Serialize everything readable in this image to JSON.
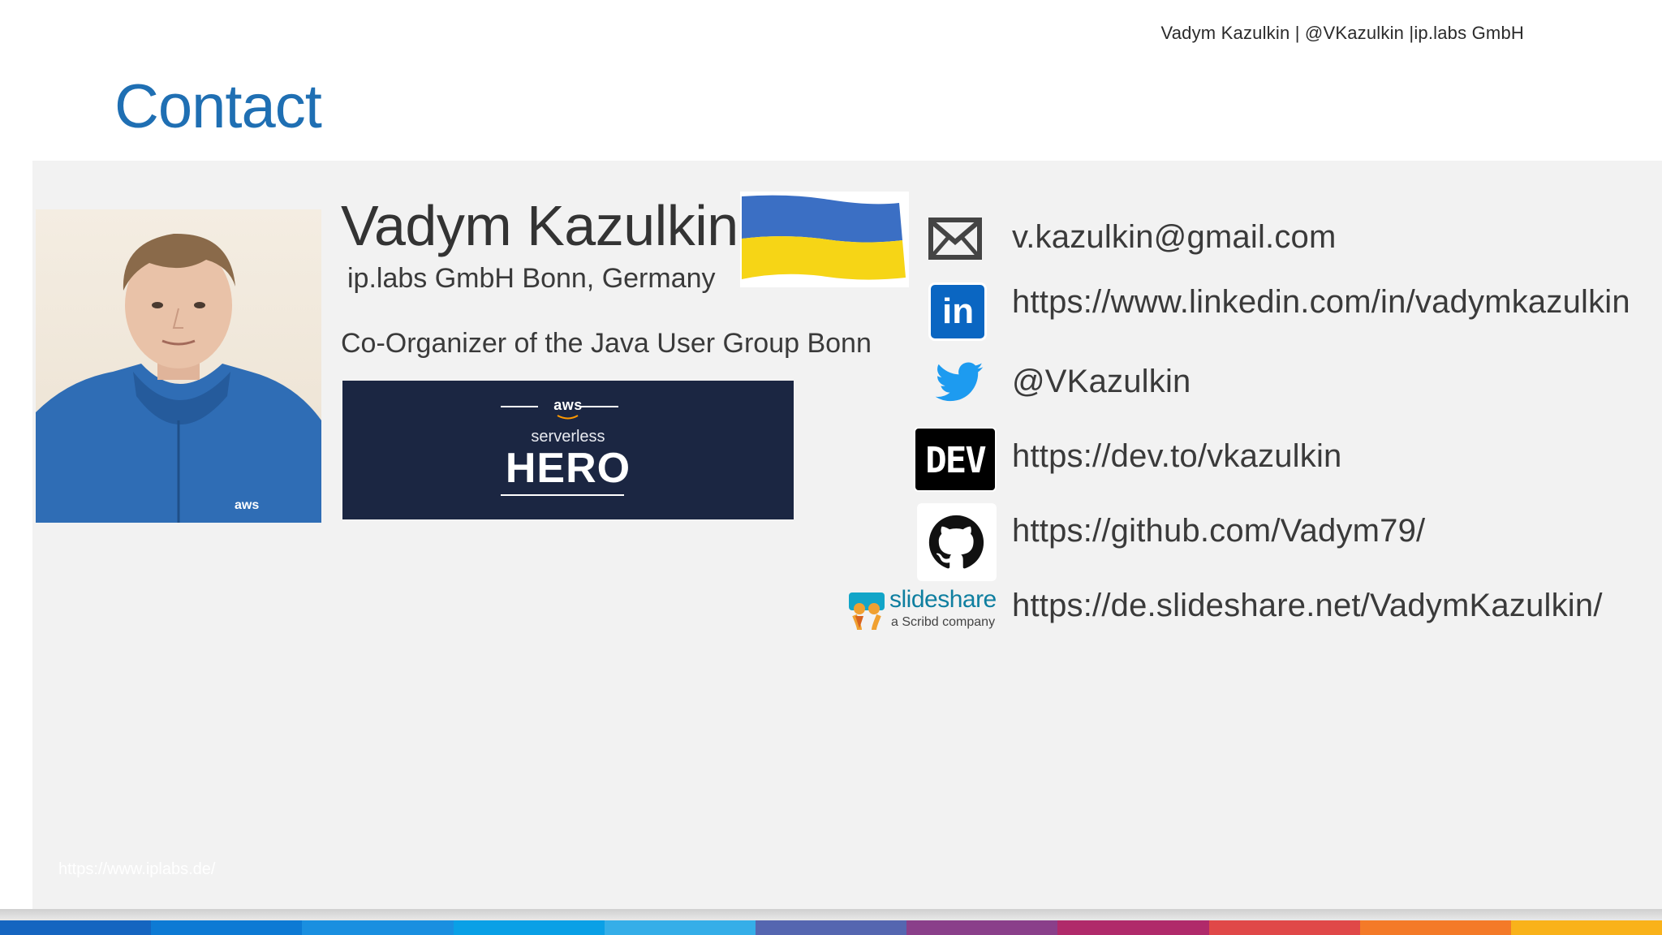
{
  "header": {
    "meta": "Vadym Kazulkin | @VKazulkin |ip.labs GmbH"
  },
  "slide": {
    "title": "Contact"
  },
  "profile": {
    "name": "Vadym Kazulkin",
    "company": "ip.labs GmbH Bonn, Germany",
    "role": "Co-Organizer of the Java User Group Bonn",
    "photo_badge": "aws"
  },
  "hero_badge": {
    "aws": "aws",
    "serverless": "serverless",
    "hero": "HERO"
  },
  "contacts": [
    {
      "icon": "mail-icon",
      "text": "v.kazulkin@gmail.com"
    },
    {
      "icon": "linkedin-icon",
      "text": "https://www.linkedin.com/in/vadymkazulkin"
    },
    {
      "icon": "twitter-icon",
      "text": "@VKazulkin"
    },
    {
      "icon": "dev-icon",
      "text": "https://dev.to/vkazulkin",
      "logo_text": "DEV"
    },
    {
      "icon": "github-icon",
      "text": "https://github.com/Vadym79/"
    },
    {
      "icon": "slideshare-icon",
      "text": "https://de.slideshare.net/VadymKazulkin/",
      "logo_text": "slideshare",
      "logo_sub": "a Scribd company"
    }
  ],
  "footer": {
    "url": "https://www.iplabs.de/"
  },
  "colors": {
    "title": "#1f6fb3",
    "panel": "#f2f2f2",
    "hero_bg": "#1b2642",
    "linkedin": "#0a66c2",
    "twitter": "#1d9bf0",
    "strip": [
      "#1565c0",
      "#0d7ad4",
      "#1a8fe0",
      "#0aa0e6",
      "#35aee8",
      "#5566b0",
      "#8a3f8a",
      "#b02a6a",
      "#e04848",
      "#f47a28",
      "#f9b21a"
    ]
  }
}
